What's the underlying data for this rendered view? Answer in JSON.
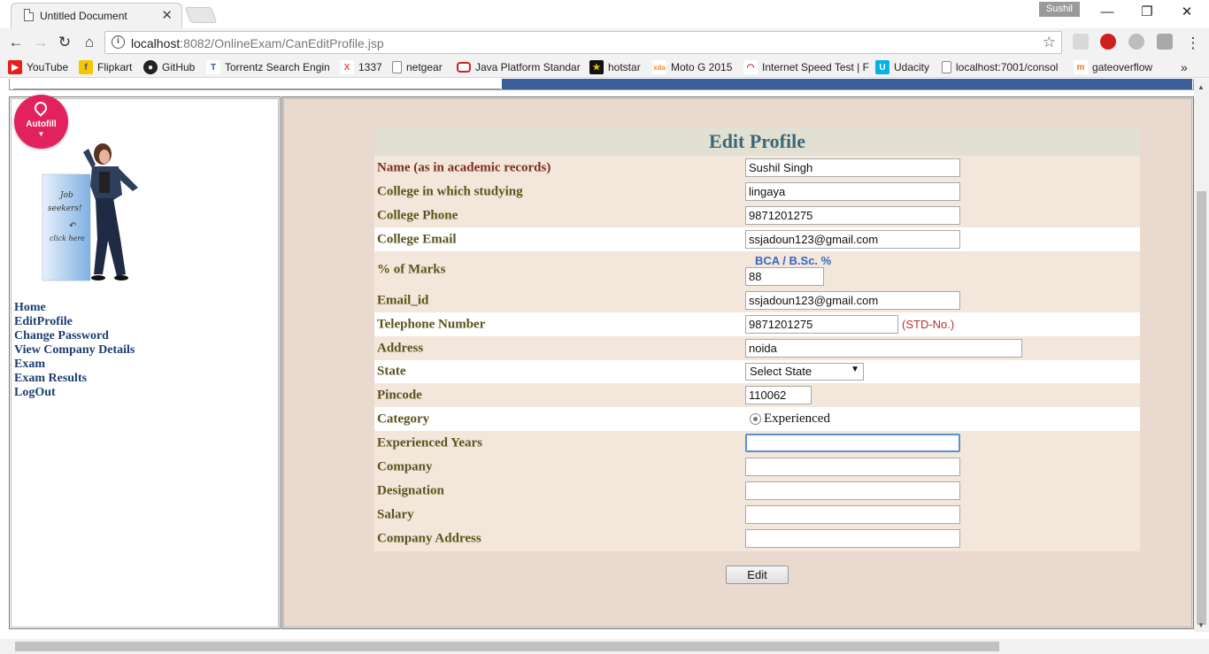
{
  "browser": {
    "tab_title": "Untitled Document",
    "profile_name": "Sushil",
    "url_host": "localhost",
    "url_rest": ":8082/OnlineExam/CanEditProfile.jsp",
    "bookmarks": [
      {
        "label": "YouTube",
        "icon": "youtube-icon",
        "color": "#e62117"
      },
      {
        "label": "Flipkart",
        "icon": "flipkart-icon",
        "color": "#f7c600"
      },
      {
        "label": "GitHub",
        "icon": "github-icon",
        "color": "#222222"
      },
      {
        "label": "Torrentz Search Engin",
        "icon": "torrentz-icon",
        "color": "#2a5aa8"
      },
      {
        "label": "1337",
        "icon": "x-icon",
        "color": "#e4572e"
      },
      {
        "label": "netgear",
        "icon": "page-icon",
        "color": "#666666"
      },
      {
        "label": "Java Platform Standar",
        "icon": "oracle-icon",
        "color": "#d0202e"
      },
      {
        "label": "hotstar",
        "icon": "hotstar-icon",
        "color": "#111111"
      },
      {
        "label": "Moto G 2015",
        "icon": "xda-icon",
        "color": "#f28b20"
      },
      {
        "label": "Internet Speed Test | F",
        "icon": "speedtest-icon",
        "color": "#c8202e"
      },
      {
        "label": "Udacity",
        "icon": "udacity-icon",
        "color": "#02b3e4"
      },
      {
        "label": "localhost:7001/consol",
        "icon": "page-icon",
        "color": "#666666"
      },
      {
        "label": "gateoverflow",
        "icon": "gateoverflow-icon",
        "color": "#e07b22"
      }
    ],
    "more_bookmarks": "»"
  },
  "autofill": {
    "label": "Autofill",
    "arrow": "▼"
  },
  "promo": {
    "text_line1": "Job",
    "text_line2": "seekers!",
    "text_line3": "click here"
  },
  "sidenav": [
    "Home",
    "EditProfile",
    "Change Password",
    "View Company Details",
    "Exam",
    "Exam Results",
    "LogOut"
  ],
  "form": {
    "title": "Edit Profile",
    "rows": [
      {
        "label": "Name  (as in academic records)",
        "value": "Sushil Singh",
        "red": true
      },
      {
        "label": "College in which studying",
        "value": "lingaya"
      },
      {
        "label": "College Phone",
        "value": "9871201275"
      },
      {
        "label": "College Email",
        "value": "ssjadoun123@gmail.com",
        "white": true
      },
      {
        "label": "% of Marks",
        "value": "88",
        "hint": "BCA / B.Sc. %"
      },
      {
        "label": "Email_id",
        "value": "ssjadoun123@gmail.com"
      },
      {
        "label": "Telephone Number",
        "value": "9871201275",
        "suffix": "(STD-No.)",
        "white": true
      },
      {
        "label": "Address",
        "value": "noida"
      },
      {
        "label": "State",
        "select": "Select State",
        "white": true
      },
      {
        "label": "Pincode",
        "value": "110062"
      },
      {
        "label": "Category",
        "radio": "Experienced",
        "white": true
      },
      {
        "label": "Experienced Years",
        "value": ""
      },
      {
        "label": "Company",
        "value": ""
      },
      {
        "label": "Designation",
        "value": ""
      },
      {
        "label": "Salary",
        "value": ""
      },
      {
        "label": "Company Address",
        "value": ""
      }
    ],
    "submit": "Edit"
  }
}
